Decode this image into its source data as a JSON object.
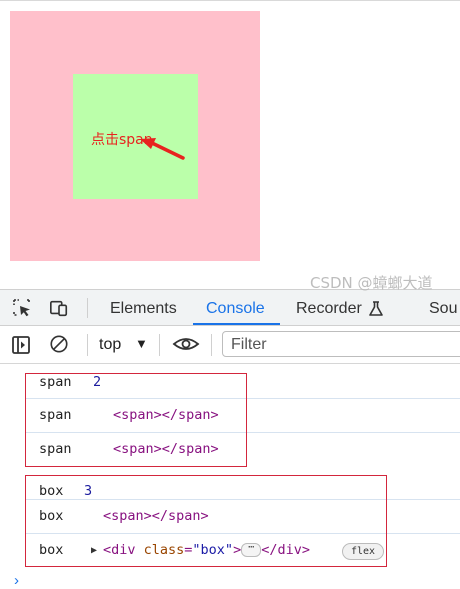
{
  "demo": {
    "span_text": "点击span",
    "outer_color": "#ffc0cb",
    "inner_color": "#bbffaa",
    "annotation_color": "#e8231f"
  },
  "devtools": {
    "tabs": [
      {
        "label": "Elements",
        "active": false
      },
      {
        "label": "Console",
        "active": true
      },
      {
        "label": "Recorder",
        "active": false
      },
      {
        "label": "Sou",
        "active": false
      }
    ],
    "toolbar": {
      "context": "top",
      "filter_placeholder": "Filter"
    },
    "logs": [
      {
        "label": "span",
        "count": "2"
      },
      {
        "label": "span",
        "node": "<span></span>"
      },
      {
        "label": "span",
        "node": "<span></span>"
      },
      {
        "label": "box",
        "count": "3"
      },
      {
        "label": "box",
        "node": "<span></span>"
      },
      {
        "label": "box",
        "node_prefix": "<div ",
        "attr_name": "class",
        "attr_eq": "=",
        "attr_value": "\"box\"",
        "node_close": ">",
        "ellipsis": "⋯",
        "node_end": "</div>",
        "badge": "flex"
      }
    ],
    "highlight_color": "#d3263d",
    "accent_color": "#1a73e8"
  },
  "watermark": "CSDN @蟑螂大道"
}
